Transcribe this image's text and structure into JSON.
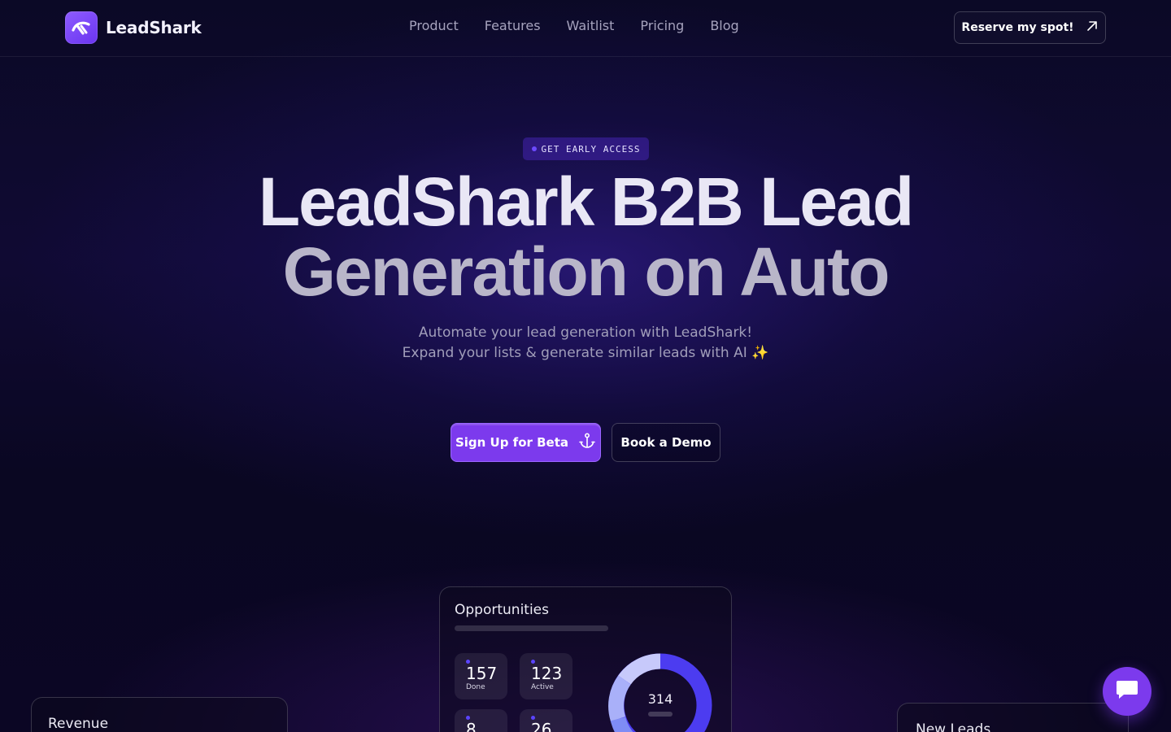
{
  "brand": {
    "name": "LeadShark",
    "logo": "leadshark-logo-icon"
  },
  "nav": {
    "links": [
      "Product",
      "Features",
      "Waitlist",
      "Pricing",
      "Blog"
    ],
    "cta_label": "Reserve my spot!",
    "cta_icon": "arrow-up-right-icon"
  },
  "hero": {
    "badge": "GET EARLY ACCESS",
    "headline_line1": "LeadShark B2B Lead",
    "headline_line2": "Generation on Auto",
    "subtitle_line1": "Automate your lead generation with LeadShark!",
    "subtitle_line2": "Expand your lists & generate similar leads with AI ✨",
    "primary_cta": "Sign Up for Beta",
    "primary_cta_icon": "anchor-icon",
    "secondary_cta": "Book a Demo"
  },
  "cards": {
    "opportunities": {
      "title": "Opportunities",
      "stats": [
        {
          "value": "157",
          "label": "Done"
        },
        {
          "value": "123",
          "label": "Active"
        },
        {
          "value": "8",
          "label": ""
        },
        {
          "value": "26",
          "label": ""
        }
      ],
      "donut_total": "314"
    },
    "revenue": {
      "title": "Revenue"
    },
    "new_leads": {
      "title": "New Leads"
    }
  },
  "chat": {
    "icon": "chat-bubble-icon"
  },
  "colors": {
    "accent": "#7c3aed",
    "background": "#0b0926",
    "donut_primary": "#4c3cf0",
    "donut_light": "#c7c9fb",
    "donut_mid": "#7f8cf5"
  }
}
